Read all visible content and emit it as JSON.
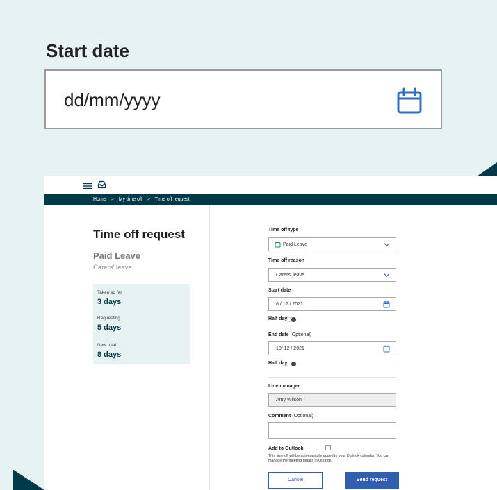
{
  "zoom": {
    "label": "Start date",
    "placeholder": "dd/mm/yyyy"
  },
  "breadcrumb": {
    "home": "Home",
    "my_time_off": "My time off",
    "current": "Time off request",
    "separator": ">"
  },
  "summary_panel": {
    "title": "Time off request",
    "leave_type": "Paid Leave",
    "leave_reason": "Carers' leave",
    "stats": [
      {
        "label": "Taken so far",
        "value": "3 days"
      },
      {
        "label": "Requesting",
        "value": "5 days"
      },
      {
        "label": "New total",
        "value": "8 days"
      }
    ]
  },
  "form": {
    "time_off_type": {
      "label": "Time off type",
      "value": "Paid Leave"
    },
    "time_off_reason": {
      "label": "Time off reason",
      "value": "Carers' leave"
    },
    "start_date": {
      "label": "Start date",
      "value": "6 / 12 / 2021"
    },
    "half_day_1": {
      "label": "Half day"
    },
    "end_date": {
      "label": "End date",
      "optional": "(Optional)",
      "value": "10/ 12 / 2021"
    },
    "half_day_2": {
      "label": "Half day"
    },
    "line_manager": {
      "label": "Line manager",
      "value": "Amy Wilson"
    },
    "comment": {
      "label": "Comment",
      "optional": "(Optional)",
      "value": ""
    },
    "outlook": {
      "label": "Add to Outlook",
      "note": "This time off will be automatically added to your Outlook calendar. You can manage the meeting details in Outlook."
    },
    "cancel_label": "Cancel",
    "send_label": "Send request"
  },
  "colors": {
    "background": "#e7f3f3",
    "header": "#003a48",
    "accent": "#2f5fae",
    "calendar_icon": "#2f6fbf"
  },
  "icons": {
    "menu": "hamburger-menu-icon",
    "inbox": "inbox-icon",
    "calendar": "calendar-icon",
    "chevron": "chevron-down-icon",
    "leave_tag": "leave-tag-icon"
  }
}
